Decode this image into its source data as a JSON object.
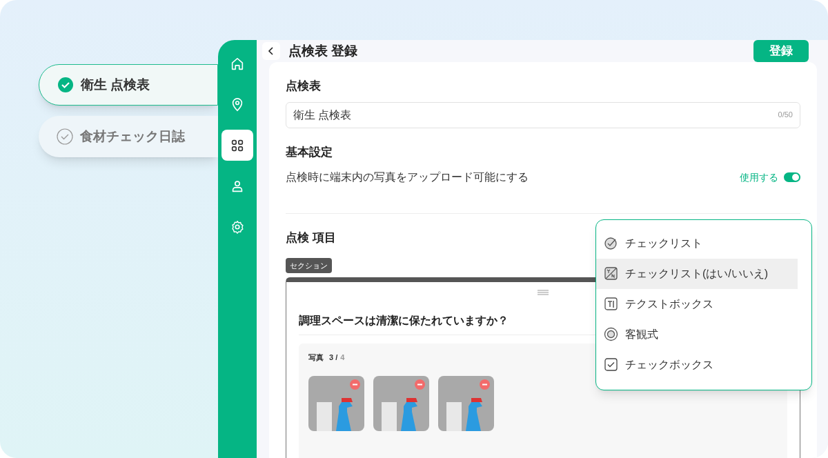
{
  "checklists": [
    {
      "label": "衛生 点検表",
      "selected": true
    },
    {
      "label": "食材チェック日誌",
      "selected": false
    }
  ],
  "nav": [
    {
      "kind": "home",
      "selected": false
    },
    {
      "kind": "location",
      "selected": false
    },
    {
      "kind": "grid",
      "selected": true
    },
    {
      "kind": "user",
      "selected": false
    },
    {
      "kind": "settings",
      "selected": false
    }
  ],
  "header": {
    "title": "点検表 登録",
    "submit": "登録"
  },
  "form": {
    "name_label": "点検表",
    "name_value": "衛生 点検表",
    "name_counter": "0/50",
    "settings_label": "基本設定",
    "photo_setting": "点検時に端末内の写真をアップロード可能にする",
    "photo_toggle_label": "使用する",
    "photo_toggle_on": true,
    "items_label": "点検 項目"
  },
  "section": {
    "tag": "セクション",
    "question": "調理スペースは清潔に保たれていますか？",
    "photo_label": "写真",
    "photo_count": "3 /",
    "photo_max": "4"
  },
  "menu": [
    {
      "kind": "checklist",
      "label": "チェックリスト",
      "selected": false
    },
    {
      "kind": "yes-no",
      "label": "チェックリスト(はい/いいえ)",
      "selected": true
    },
    {
      "kind": "textbox",
      "label": "テクストボックス",
      "selected": false
    },
    {
      "kind": "radio",
      "label": "客観式",
      "selected": false
    },
    {
      "kind": "checkbox",
      "label": "チェックボックス",
      "selected": false
    }
  ]
}
